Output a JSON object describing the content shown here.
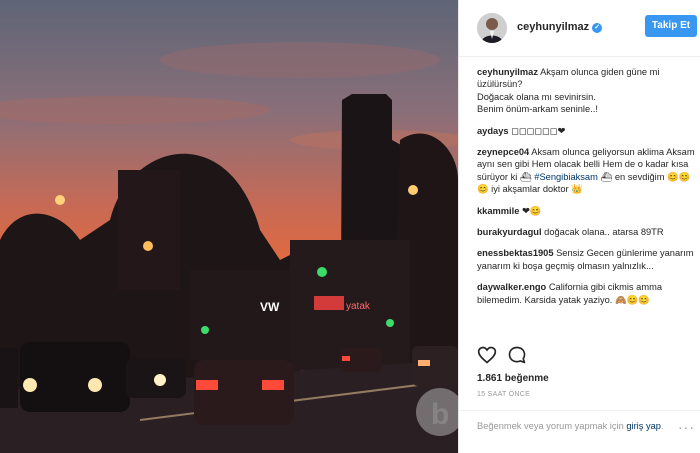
{
  "post": {
    "username": "ceyhunyilmaz",
    "follow_label": "Takip Et",
    "caption": {
      "user": "ceyhunyilmaz",
      "lines": [
        "Akşam olunca giden güne mi üzülürsün?",
        "Doğacak olana mı sevinirsin.",
        "Benim önüm-arkam seninle..!"
      ]
    },
    "comments": [
      {
        "user": "aydays",
        "text": "◻◻◻◻◻◻❤"
      },
      {
        "user": "zeynepce04",
        "text_a": "Aksam olunca geliyorsun aklima Aksam aynı sen gibi Hem olacak belli Hem de o kadar kısa sürüyor ki ⛴",
        "tag": "#Sengibiaksam",
        "text_b": "⛴ en sevdiğim 😊😊😊 iyi akşamlar doktor 👑"
      },
      {
        "user": "kkammile",
        "text": "❤😊"
      },
      {
        "user": "burakyurdagul",
        "text": "doğacak olana.. atarsa 89TR"
      },
      {
        "user": "enessbektas1905",
        "text": "Sensiz Gecen günlerime yanarım yanarım ki boşa geçmiş olmasın yalnızlık..."
      },
      {
        "user": "daywalker.engo",
        "text": "California gibi cikmis amma bilemedim. Karsida yatak yaziyo. 🙈😊😊"
      }
    ],
    "likes": "1.861 beğenme",
    "time": "15 SAAT ÖNCE",
    "add_comment_a": "Beğenmek veya yorum yapmak için ",
    "add_comment_link": "giriş yap",
    "add_comment_b": ".",
    "more": "···"
  },
  "photo": {
    "sign_1": "VW",
    "sign_2": "yatak",
    "watermark": "b"
  }
}
